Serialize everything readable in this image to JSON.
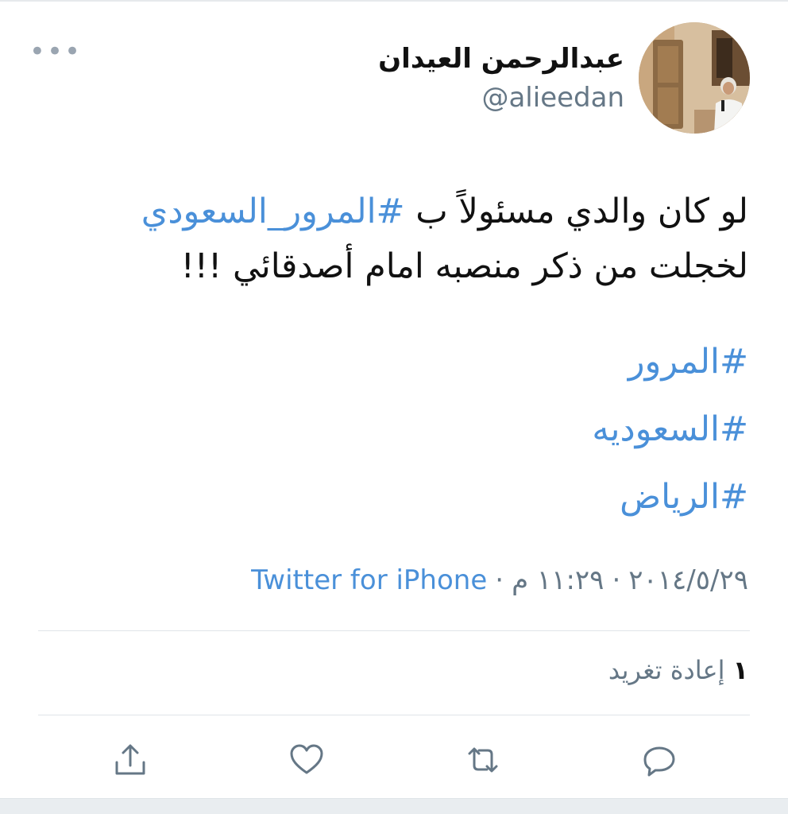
{
  "user": {
    "display_name": "عبدالرحمن العيدان",
    "handle": "@alieedan"
  },
  "tweet": {
    "line1_text": "لو كان والدي مسئولاً ب ",
    "line1_hashtag": "#المرور_السعودي",
    "line2_text": "لخجلت من ذكر منصبه امام أصدقائي !!!",
    "hashtags": [
      "#المرور",
      "#السعوديه",
      "#الرياض"
    ]
  },
  "meta": {
    "date": "٢٠١٤/٥/٢٩",
    "separator": "·",
    "time": "١١:٢٩ م",
    "source": "Twitter for iPhone"
  },
  "stats": {
    "retweet_count": "١",
    "retweet_label": "إعادة تغريد"
  },
  "actions": {
    "reply_icon": "reply-icon",
    "retweet_icon": "retweet-icon",
    "like_icon": "heart-icon",
    "share_icon": "share-icon"
  },
  "colors": {
    "accent": "#4a90d9",
    "muted": "#657786",
    "icon": "#657786",
    "divider": "#dfe4e8"
  }
}
